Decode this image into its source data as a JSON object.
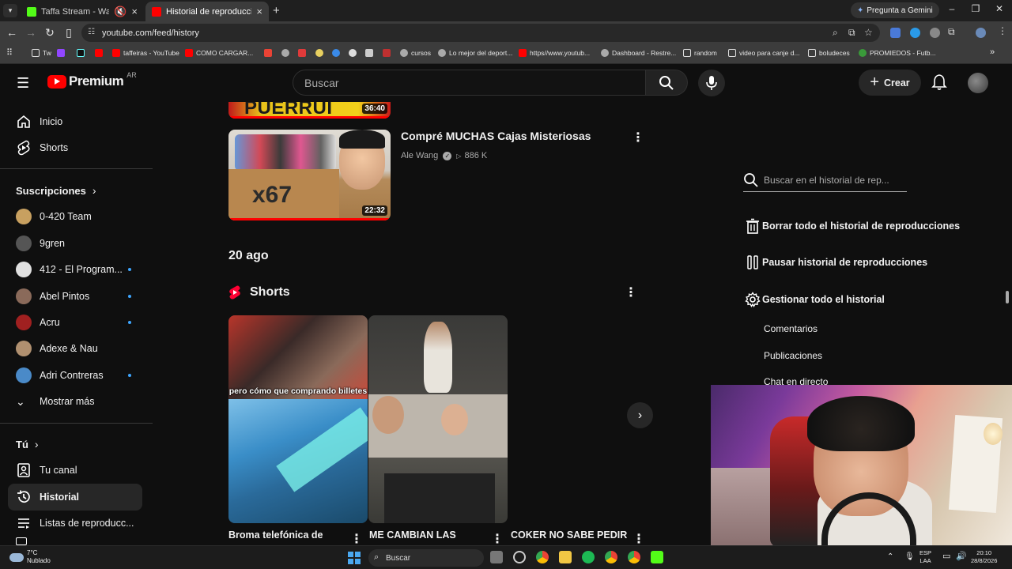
{
  "browser": {
    "tabs": [
      {
        "title": "Taffa Stream - Watch Live o",
        "color": "#53fc18"
      },
      {
        "title": "Historial de reproducciones - Yo",
        "color": "#ff0000"
      }
    ],
    "gemini_label": "Pregunta a Gemini",
    "url": "youtube.com/feed/history",
    "bookmarks": [
      {
        "label": "Tw",
        "icon": "folder-icon"
      },
      {
        "label": "",
        "icon": "tiktok-icon"
      },
      {
        "label": "",
        "icon": "youtube-icon"
      },
      {
        "label": "taffeiras - YouTube",
        "icon": "youtube-icon"
      },
      {
        "label": "COMO CARGAR...",
        "icon": "youtube-icon"
      },
      {
        "label": "cursos",
        "icon": "globe-icon"
      },
      {
        "label": "Lo mejor del deport...",
        "icon": "globe-icon"
      },
      {
        "label": "https//www.youtub...",
        "icon": "youtube-icon"
      },
      {
        "label": "Dashboard - Restre...",
        "icon": "globe-icon"
      },
      {
        "label": "random",
        "icon": "folder-icon"
      },
      {
        "label": "video para canje d...",
        "icon": "folder-icon"
      },
      {
        "label": "boludeces",
        "icon": "folder-icon"
      },
      {
        "label": "PROMIEDOS - Futb...",
        "icon": "promiedos-icon"
      }
    ]
  },
  "youtube": {
    "logo": {
      "word": "Premium",
      "country": "AR"
    },
    "search_placeholder": "Buscar",
    "create_label": "Crear",
    "sidebar": {
      "main": [
        {
          "label": "Inicio",
          "icon": "home-icon"
        },
        {
          "label": "Shorts",
          "icon": "shorts-icon"
        }
      ],
      "subscriptions_title": "Suscripciones",
      "subscriptions": [
        {
          "label": "0-420 Team",
          "color": "#c8a060",
          "new": false
        },
        {
          "label": "9gren",
          "color": "#555555",
          "new": false
        },
        {
          "label": "412 - El Program...",
          "color": "#e0e0e0",
          "new": true
        },
        {
          "label": "Abel Pintos",
          "color": "#8a6a5a",
          "new": true
        },
        {
          "label": "Acru",
          "color": "#a02020",
          "new": true
        },
        {
          "label": "Adexe & Nau",
          "color": "#b09070",
          "new": false
        },
        {
          "label": "Adri Contreras",
          "color": "#4a8ac8",
          "new": true
        }
      ],
      "show_more": "Mostrar más",
      "you_title": "Tú",
      "you": [
        {
          "label": "Tu canal",
          "icon": "channel-icon"
        },
        {
          "label": "Historial",
          "icon": "history-icon"
        },
        {
          "label": "Listas de reproducc...",
          "icon": "playlists-icon"
        }
      ]
    },
    "history": {
      "prev_video": {
        "overlay_text": "PUERRUI",
        "duration": "36:40"
      },
      "video": {
        "title": "Compré MUCHAS Cajas Misteriosas",
        "channel": "Ale Wang",
        "views": "886 K",
        "duration": "22:32",
        "thumb_text": "x67"
      },
      "date_header": "20 ago",
      "shorts_title": "Shorts",
      "shorts": [
        {
          "title": "Broma telefónica de",
          "caption": "pero cómo que comprando billetes"
        },
        {
          "title": "ME CAMBIAN LAS",
          "caption": ""
        },
        {
          "title": "COKER NO SABE PEDIR",
          "caption": ""
        }
      ]
    },
    "panel": {
      "search_placeholder": "Buscar en el historial de rep...",
      "actions": [
        {
          "label": "Borrar todo el historial de reproducciones",
          "icon": "trash-icon"
        },
        {
          "label": "Pausar historial de reproducciones",
          "icon": "pause-icon"
        },
        {
          "label": "Gestionar todo el historial",
          "icon": "gear-icon"
        }
      ],
      "links": [
        "Comentarios",
        "Publicaciones",
        "Chat en directo"
      ]
    }
  },
  "taskbar": {
    "weather_temp": "7°C",
    "weather_desc": "Nublado",
    "search_label": "Buscar",
    "lang_top": "ESP",
    "lang_bottom": "LAA",
    "time": "20:10",
    "date": "28/8/2026"
  },
  "colors": {
    "yt_bg": "#0f0f0f",
    "yt_red": "#ff0000",
    "accent_blue": "#3ea6ff"
  }
}
